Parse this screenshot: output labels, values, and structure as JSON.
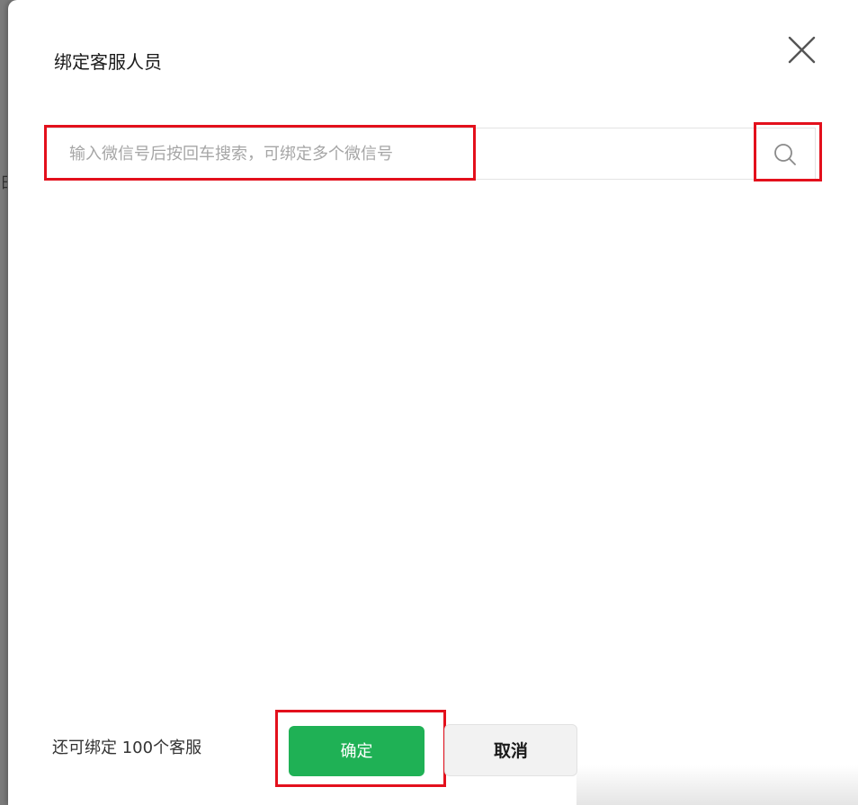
{
  "dialog": {
    "title": "绑定客服人员",
    "close_icon": "close-icon"
  },
  "backdrop": {
    "peek_text": "日"
  },
  "search": {
    "placeholder": "输入微信号后按回车搜索，可绑定多个微信号",
    "value": "",
    "button_icon": "search-icon"
  },
  "footer": {
    "remaining_note": "还可绑定 100个客服",
    "confirm_label": "确定",
    "cancel_label": "取消"
  },
  "colors": {
    "confirm_bg": "#1fb155",
    "highlight": "#e3101c",
    "cancel_bg": "#f2f2f2"
  }
}
